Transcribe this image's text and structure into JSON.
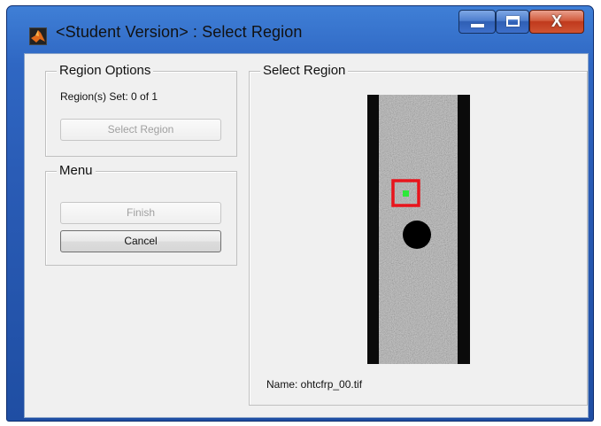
{
  "window": {
    "title": "<Student Version> : Select Region",
    "icon": "matlab-icon",
    "buttons": {
      "minimize": "minimize-icon",
      "maximize": "maximize-icon",
      "close": "X"
    }
  },
  "region_options": {
    "legend": "Region Options",
    "status": "Region(s) Set: 0 of 1",
    "select_button": "Select Region"
  },
  "menu": {
    "legend": "Menu",
    "finish_button": "Finish",
    "cancel_button": "Cancel"
  },
  "select_region": {
    "legend": "Select Region",
    "file_label": "Name: ohtcfrp_00.tif"
  },
  "colors": {
    "selection_box": "#e8141c",
    "seed_point": "#2ee83a",
    "hole": "#000000",
    "specimen": "#a8a8a8"
  }
}
